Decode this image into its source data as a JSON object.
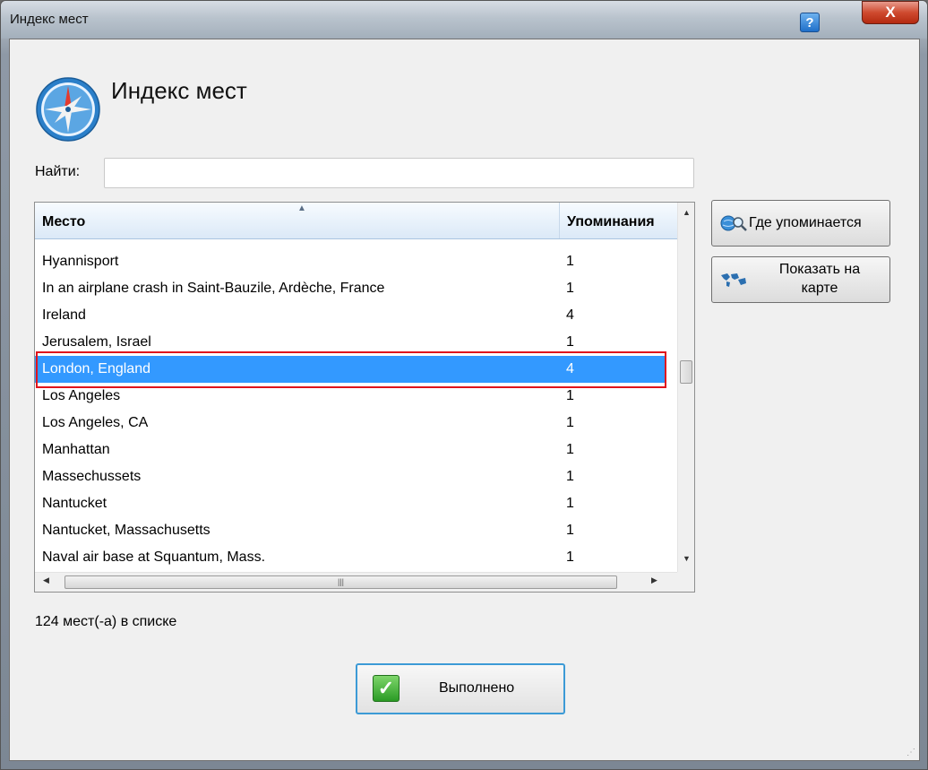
{
  "window": {
    "title": "Индекс мест",
    "help": "?",
    "close": "X"
  },
  "header": {
    "title": "Индекс мест",
    "logo_icon": "compass-icon"
  },
  "search": {
    "label": "Найти:",
    "value": ""
  },
  "grid": {
    "columns": [
      "Место",
      "Упоминания"
    ],
    "rows": [
      [
        "Hyannisport",
        "1"
      ],
      [
        "In an airplane crash in Saint-Bauzile, Ardèche, France",
        "1"
      ],
      [
        "Ireland",
        "4"
      ],
      [
        "Jerusalem, Israel",
        "1"
      ],
      [
        "London, England",
        "4"
      ],
      [
        "Los Angeles",
        "1"
      ],
      [
        "Los Angeles, CA",
        "1"
      ],
      [
        "Manhattan",
        "1"
      ],
      [
        "Massechussets",
        "1"
      ],
      [
        "Nantucket",
        "1"
      ],
      [
        "Nantucket, Massachusetts",
        "1"
      ],
      [
        "Naval air base at Squantum, Mass.",
        "1"
      ]
    ],
    "selected_index": 4
  },
  "buttons": {
    "where_mentioned": "Где упоминается",
    "show_on_map_line1": "Показать на",
    "show_on_map_line2": "карте",
    "done": "Выполнено"
  },
  "status": {
    "count_text": "124 мест(-а) в списке"
  },
  "colors": {
    "selection": "#3399ff",
    "highlight_outline": "#e0141c",
    "done_border": "#3c9ad6"
  }
}
